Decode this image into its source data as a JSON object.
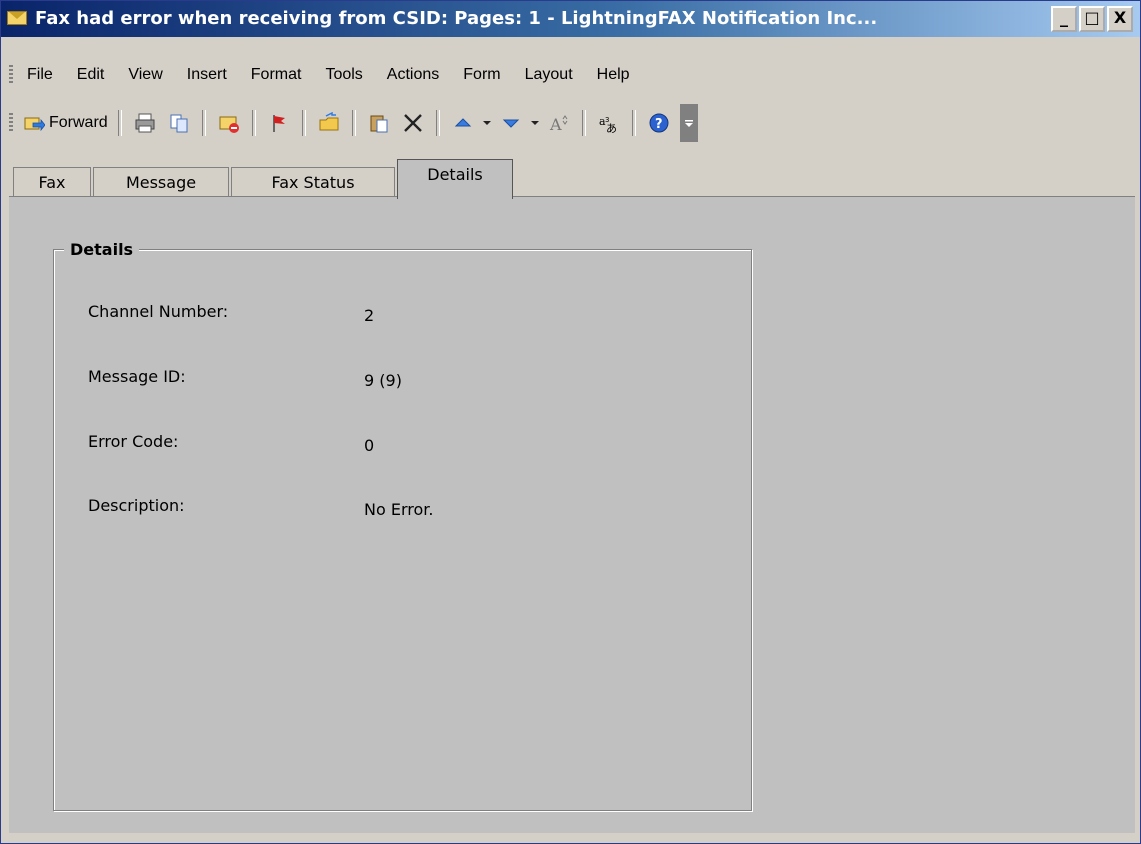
{
  "window": {
    "title": "Fax had error when receiving from CSID:   Pages: 1 - LightningFAX Notification Inc...",
    "buttons": {
      "minimize": "_",
      "maximize": "□",
      "close": "X"
    }
  },
  "menu": [
    "File",
    "Edit",
    "View",
    "Insert",
    "Format",
    "Tools",
    "Actions",
    "Form",
    "Layout",
    "Help"
  ],
  "toolbar": {
    "forward_label": "Forward",
    "icons": [
      "forward-icon",
      "print-icon",
      "copy-icon",
      "reply-icon",
      "flag-icon",
      "move-to-folder-icon",
      "paste-icon",
      "delete-icon",
      "previous-item-icon",
      "next-item-icon",
      "font-size-icon",
      "encoding-icon",
      "help-icon"
    ]
  },
  "tabs": [
    "Fax",
    "Message",
    "Fax Status",
    "Details"
  ],
  "active_tab": "Details",
  "details": {
    "group_title": "Details",
    "fields": [
      {
        "label": "Channel Number:",
        "value": "2"
      },
      {
        "label": "Message ID:",
        "value": "9 (9)"
      },
      {
        "label": "Error Code:",
        "value": "0"
      },
      {
        "label": "Description:",
        "value": "No Error."
      }
    ]
  },
  "colors": {
    "title_start": "#0a246a",
    "title_end": "#a6caf0",
    "face": "#d4d0c8",
    "panel": "#c0c0c0"
  }
}
